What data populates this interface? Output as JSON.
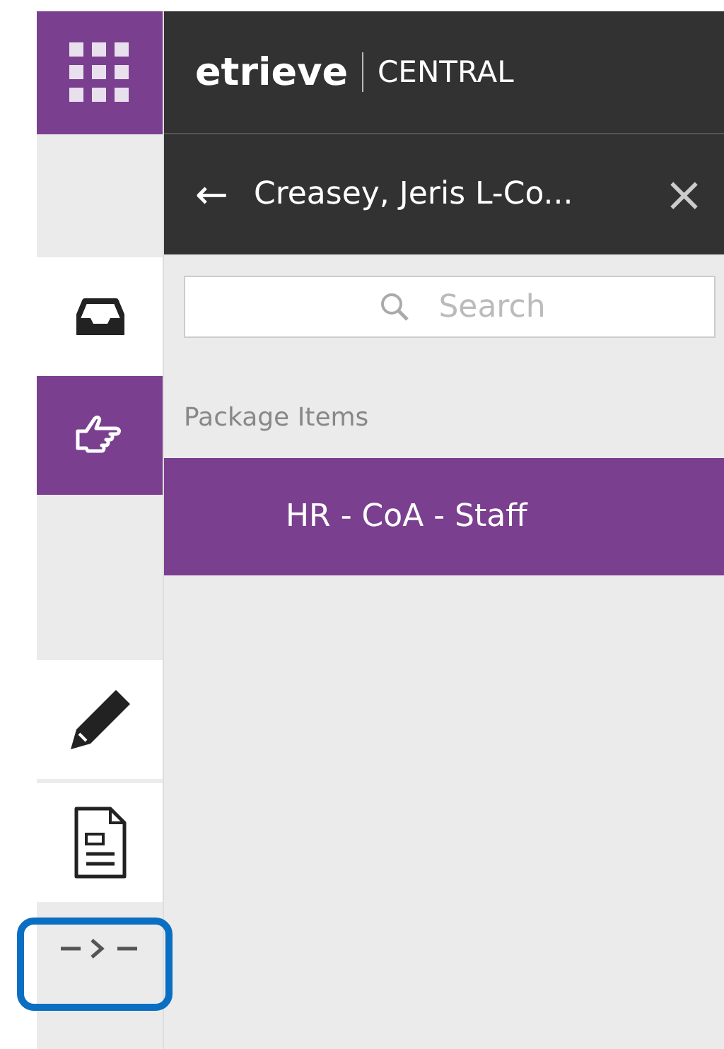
{
  "header": {
    "logo": "etrieve",
    "product": "CENTRAL"
  },
  "sidebar": {
    "items": [
      {
        "kind": "inbox",
        "selected": false
      },
      {
        "kind": "pointer",
        "selected": true
      },
      {
        "kind": "edit",
        "selected": false
      },
      {
        "kind": "document",
        "selected": false
      },
      {
        "kind": "expand",
        "selected": false,
        "highlighted": true
      }
    ]
  },
  "panel": {
    "back": "←",
    "title": "Creasey, Jeris L-Co...",
    "close": "×",
    "search": {
      "placeholder": "Search"
    },
    "section_label": "Package Items",
    "items": [
      {
        "label": "HR - CoA - Staff",
        "selected": true
      }
    ]
  }
}
